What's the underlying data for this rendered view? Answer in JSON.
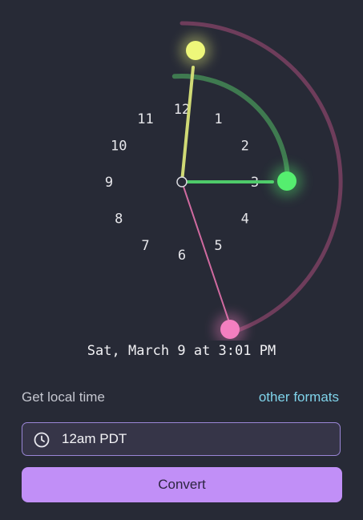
{
  "clock": {
    "numbers": [
      "12",
      "1",
      "2",
      "3",
      "4",
      "5",
      "6",
      "7",
      "8",
      "9",
      "10",
      "11"
    ],
    "colors": {
      "hour_hand": "#cfd975",
      "hour_knob": "#eef77a",
      "minute_hand": "#4fca6a",
      "minute_knob": "#55ee6f",
      "minute_arc": "#3f7a50",
      "second_hand": "#d06aa0",
      "second_knob": "#f47fc0",
      "second_arc": "#6e3d5b"
    }
  },
  "datetime_text": "Sat, March 9 at 3:01 PM",
  "form": {
    "label": "Get local time",
    "formats_link": "other formats",
    "input_value": "12am PDT",
    "input_icon": "clock-icon",
    "convert_label": "Convert"
  }
}
